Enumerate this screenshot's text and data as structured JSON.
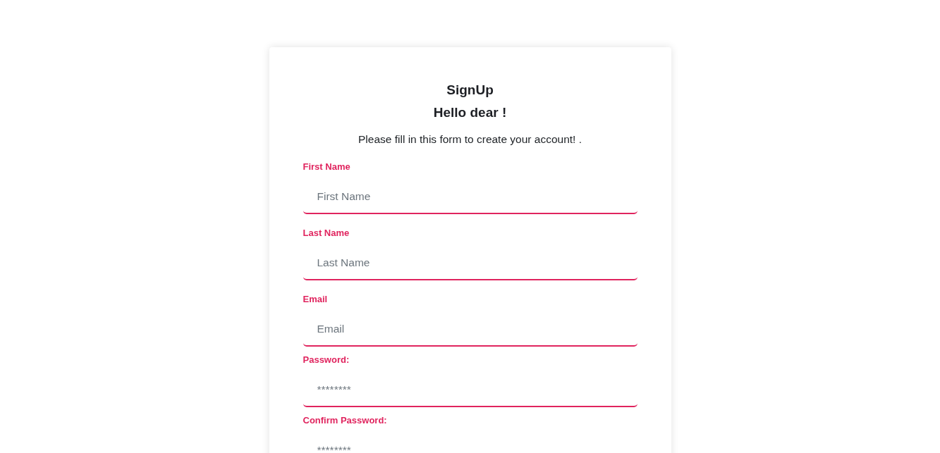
{
  "card": {
    "title": "SignUp",
    "greeting": "Hello dear !",
    "intro": "Please fill in this form to create your account! .",
    "fields": [
      {
        "kind": "text",
        "label": "First Name",
        "placeholder": "First Name"
      },
      {
        "kind": "text",
        "label": "Last Name",
        "placeholder": "Last Name"
      },
      {
        "kind": "email",
        "label": "Email",
        "placeholder": "Email"
      },
      {
        "kind": "password",
        "label": "Password:",
        "placeholder": "********"
      },
      {
        "kind": "password",
        "label": "Confirm Password:",
        "placeholder": "********"
      }
    ]
  }
}
